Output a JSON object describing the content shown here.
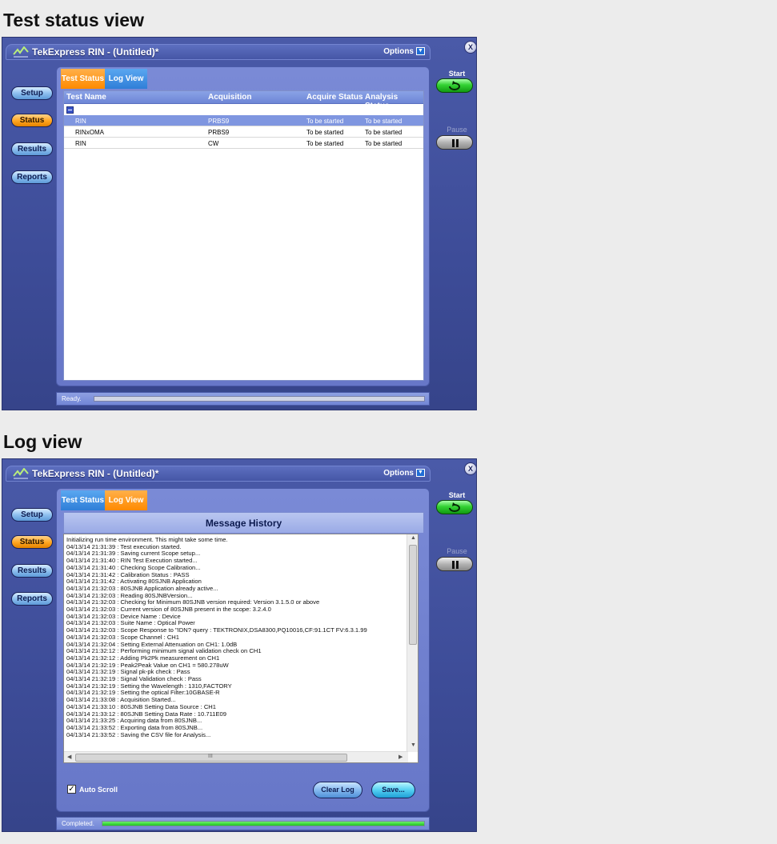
{
  "sections": {
    "status_title": "Test status view",
    "log_title": "Log view"
  },
  "app": {
    "title": "TekExpress RIN  - (Untitled)*",
    "options_label": "Options",
    "close_glyph": "X",
    "nav": {
      "setup": "Setup",
      "status": "Status",
      "results": "Results",
      "reports": "Reports"
    },
    "start_label": "Start",
    "pause_label": "Pause"
  },
  "status_view": {
    "tabs": {
      "test_status": "Test Status",
      "log_view": "Log View"
    },
    "columns": [
      "Test Name",
      "Acquisition",
      "Acquire Status",
      "Analysis Status"
    ],
    "rows": [
      {
        "test": "RIN",
        "acq": "PRBS9",
        "acq_status": "To be started",
        "ana_status": "To be started",
        "selected": true
      },
      {
        "test": "RINxOMA",
        "acq": "PRBS9",
        "acq_status": "To be started",
        "ana_status": "To be started",
        "selected": false
      },
      {
        "test": "RIN",
        "acq": "CW",
        "acq_status": "To be started",
        "ana_status": "To be started",
        "selected": false
      }
    ],
    "status_text": "Ready.",
    "progress": 0
  },
  "log_view": {
    "tabs": {
      "test_status": "Test Status",
      "log_view": "Log View"
    },
    "header": "Message History",
    "lines": [
      "Initializing run time environment. This might take some time.",
      "04/13/14 21:31:39 : Test execution started.",
      "04/13/14 21:31:39 : Saving current Scope setup...",
      "04/13/14 21:31:40 : RIN Test Execution started...",
      "04/13/14 21:31:40 : Checking Scope Calibration...",
      "04/13/14 21:31:42 : Calibration Status : PASS",
      "04/13/14 21:31:42 : Activating 80SJNB Application",
      "04/13/14 21:32:03 : 80SJNB Application already active...",
      "04/13/14 21:32:03 : Reading 80SJNBVersion...",
      "04/13/14 21:32:03 : Checking for Minimum 80SJNB version required: Version 3.1.5.0 or above",
      "04/13/14 21:32:03 : Current version of 80SJNB present in the scope:  3.2.4.0",
      "04/13/14 21:32:03 : Device Name : Device",
      "04/13/14 21:32:03 : Suite Name : Optical Power",
      "04/13/14 21:32:03 : Scope Response to \"IDN? query : TEKTRONIX,DSA8300,PQ10016,CF:91.1CT FV:6.3.1.99",
      "04/13/14 21:32:03 : Scope Channel : CH1",
      "04/13/14 21:32:04 : Setting External Attenuation on CH1: 1.0dB",
      "04/13/14 21:32:12 : Performing minimum signal validation check on CH1",
      "04/13/14 21:32:12 : Adding Pk2Pk measurement on CH1",
      "04/13/14 21:32:19 : Peak2Peak Value on CH1 = 580.278uW",
      "04/13/14 21:32:19 : Signal pk-pk check : Pass",
      "04/13/14 21:32:19 : Signal Validation check : Pass",
      "04/13/14 21:32:19 : Setting the Wavelength : 1310,FACTORY",
      "04/13/14 21:32:19 : Setting the optical Filter:10GBASE-R",
      "04/13/14 21:33:08 : Acquisition Started...",
      "04/13/14 21:33:10 : 80SJNB Setting Data Source : CH1",
      "04/13/14 21:33:12 : 80SJNB Setting Data Rate : 10.711E09",
      "04/13/14 21:33:25 : Acquiring data from 80SJNB...",
      "04/13/14 21:33:52 : Exporting data from 80SJNB...",
      "04/13/14 21:33:52 : Saving the CSV file for Analysis..."
    ],
    "auto_scroll_label": "Auto Scroll",
    "auto_scroll_checked": true,
    "clear_log_label": "Clear Log",
    "save_label": "Save...",
    "scroll_marker": "III",
    "status_text": "Completed.",
    "progress": 1
  }
}
